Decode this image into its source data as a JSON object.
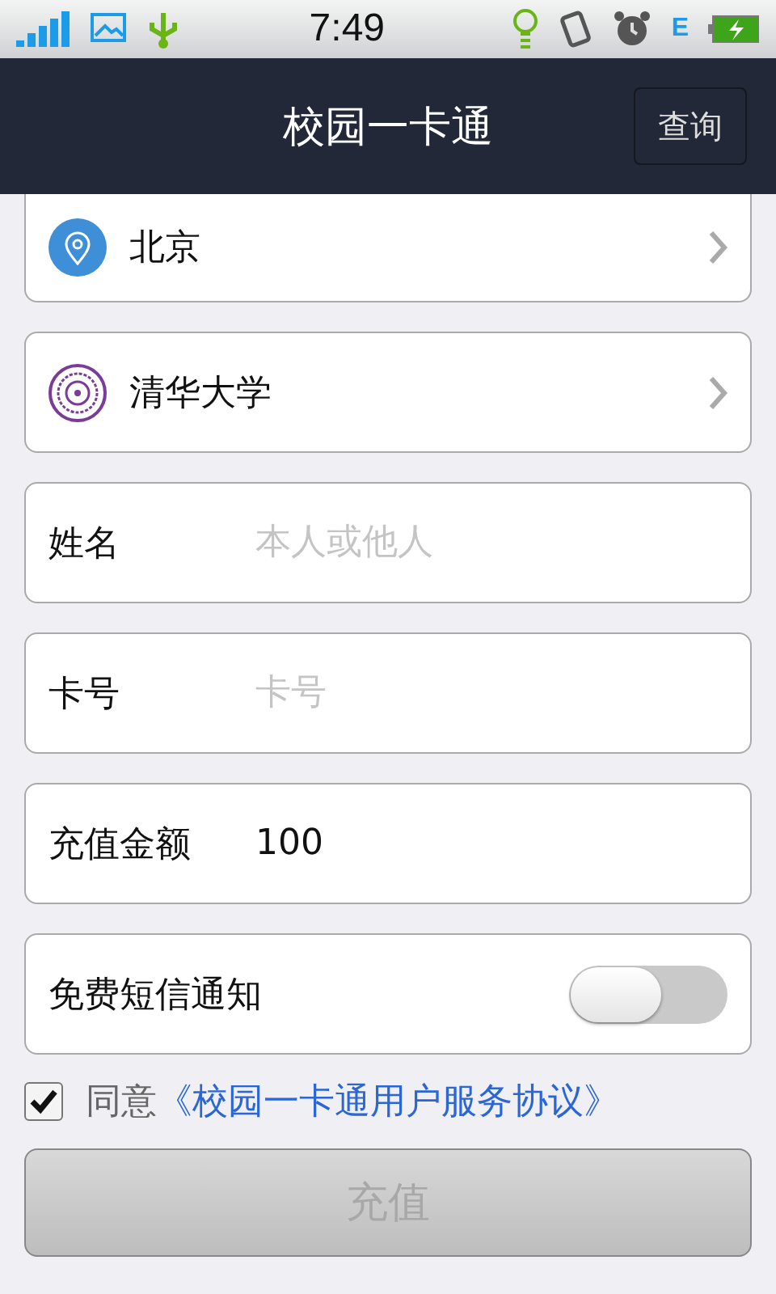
{
  "status_bar": {
    "time": "7:49",
    "network_type": "E"
  },
  "header": {
    "title": "校园一卡通",
    "action": "查询"
  },
  "selectors": [
    {
      "kind": "location",
      "label": "北京"
    },
    {
      "kind": "school",
      "label": "清华大学"
    }
  ],
  "fields": [
    {
      "label": "姓名",
      "placeholder": "本人或他人"
    },
    {
      "label": "卡号",
      "placeholder": "卡号"
    },
    {
      "label": "充值金额",
      "value": "100"
    }
  ],
  "sms_toggle": {
    "label": "免费短信通知",
    "on": false
  },
  "agreement": {
    "checked": true,
    "text": "同意",
    "link": "《校园一卡通用户服务协议》"
  },
  "submit": {
    "label": "充值",
    "disabled": true
  }
}
